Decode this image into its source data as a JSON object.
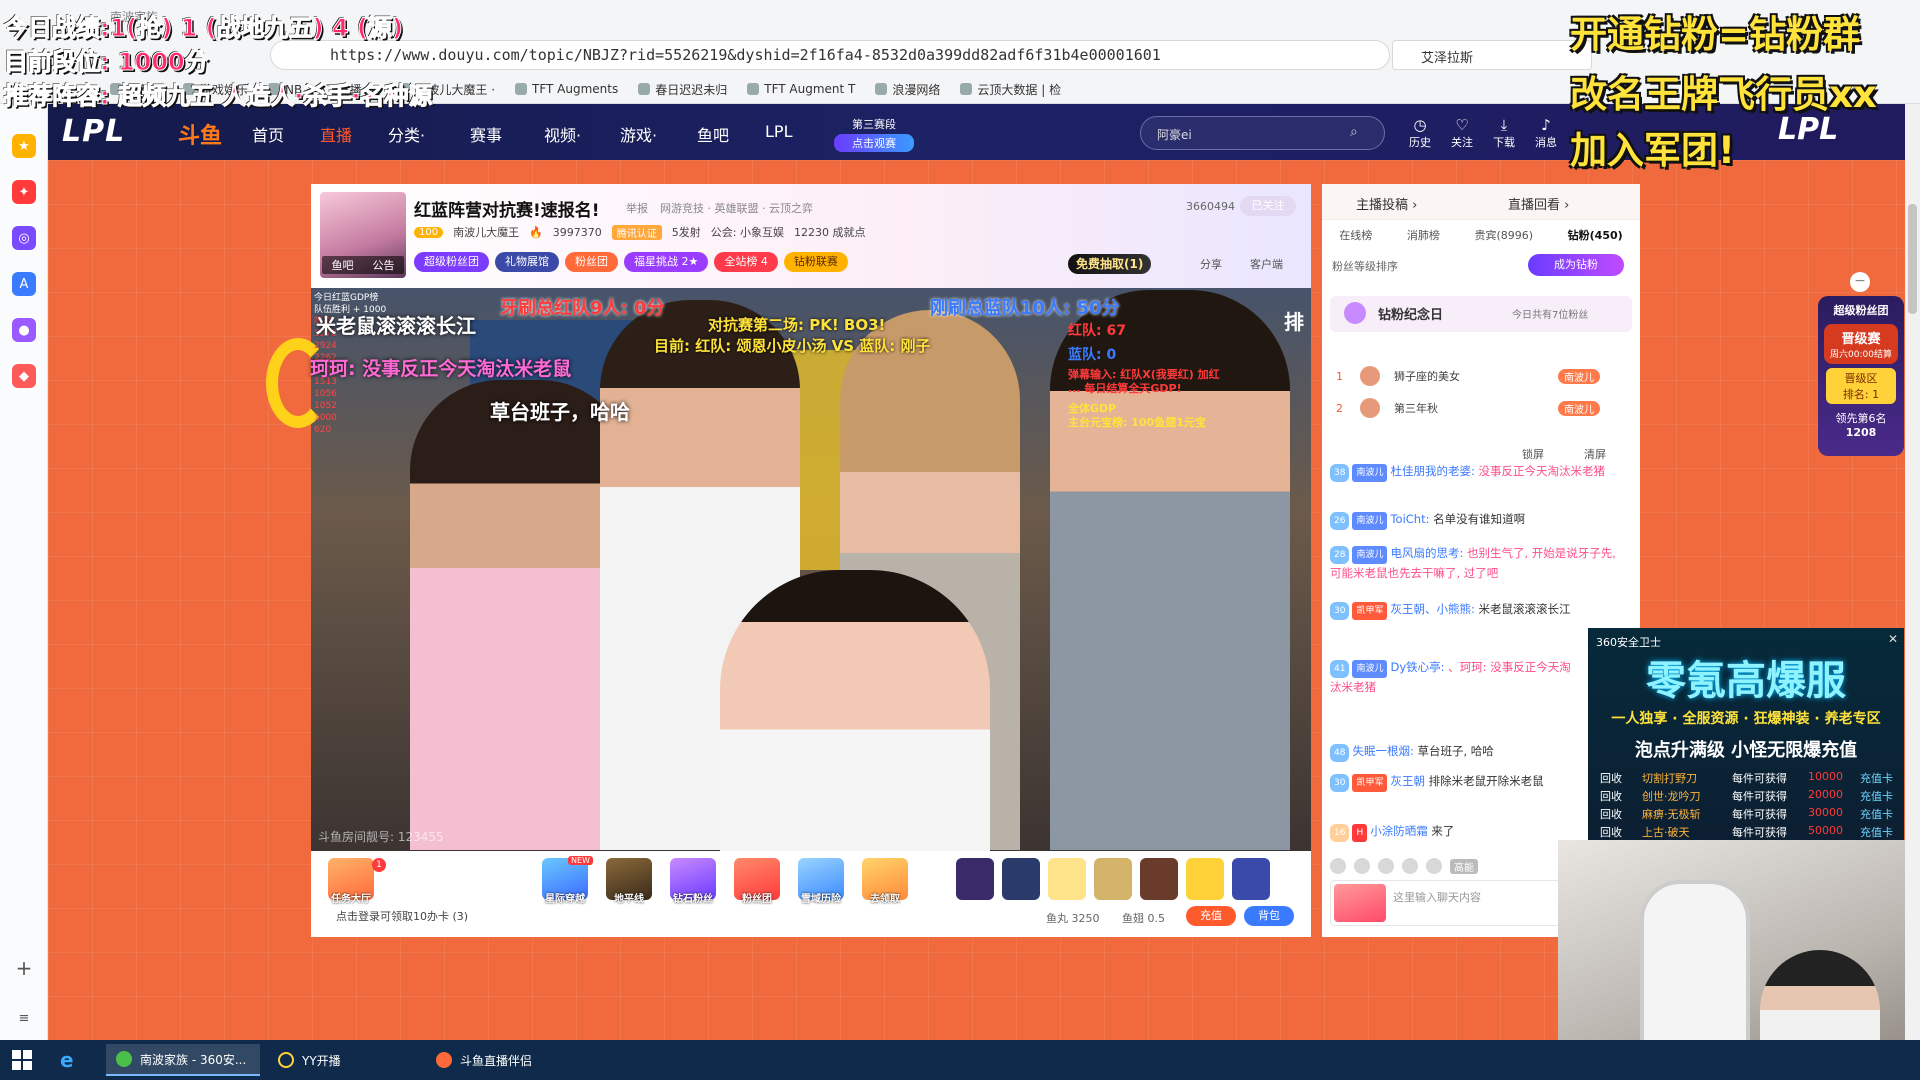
{
  "browser": {
    "window_title": "南波家族",
    "url": "https://www.douyu.com/topic/NBJZ?rid=5526219&dyshid=2f16fa4-8532d0a399dd82adf6f31b4e00001601",
    "search_value": "艾泽拉斯",
    "bookmarks": [
      "点新闻",
      "游戏娱乐",
      "NB · 小飞直播_lo",
      "南波儿大魔王 ·",
      "TFT Augments",
      "春日迟迟未归",
      "TFT Augment T",
      "浪漫网络",
      "云顶大数据 | 检"
    ]
  },
  "stream_overlay_left": {
    "line1": "今日战绩:1(抢) 1 (战地九五) 4 (源)",
    "line2": "目前段位: 1000分",
    "line3": "推荐阵容: 超频九五 人造人·杀手·名种源"
  },
  "stream_overlay_right": {
    "line1": "开通钻粉=钻粉群",
    "line2": "改名王牌飞行员xx",
    "line3": "加入军团!"
  },
  "site_nav": {
    "logo": "LPL",
    "logo_site": "斗鱼",
    "items": [
      "首页",
      "直播",
      "分类·",
      "赛事",
      "视频·",
      "游戏·",
      "鱼吧",
      "LPL"
    ],
    "stage_badge_line1": "第三赛段",
    "stage_badge_line2": "点击观赛",
    "search_placeholder": "阿豪ei",
    "tools": [
      "历史",
      "关注",
      "下载",
      "消息"
    ],
    "right_logo": "LPL"
  },
  "room": {
    "title": "红蓝阵营对抗赛!速报名!",
    "report": "举报",
    "tags": "网游竞技 · 英雄联盟 · 云顶之弈",
    "hot_count": "3660494",
    "followed_label": "已关注",
    "avatar_tabs": [
      "鱼吧",
      "公告"
    ],
    "anchor_level": "100",
    "anchor_name": "南波儿大魔王",
    "heat": "3997370",
    "verify": "腾讯认证",
    "fans_label": "5发射",
    "guild": "公会: 小象互娱",
    "achievement": "12230 成就点",
    "pills": [
      "超级粉丝团",
      "礼物展馆",
      "粉丝团",
      "福星挑战 2★",
      "全站榜 4",
      "钻粉联赛"
    ],
    "free_draw": "免费抽取(1)",
    "share": "分享",
    "client": "客户端"
  },
  "video_overlay": {
    "list_header": "今日红蓝GDP榜",
    "list_sub": "队伍胜利 + 1000",
    "list_rows": [
      "阿豪",
      "5278",
      "2924",
      "2262",
      "2107",
      "1513",
      "1056",
      "1052",
      "1000",
      "620"
    ],
    "red_team": "牙刷总红队9人: 0分",
    "blue_team": "刚刷总蓝队10人: 50分",
    "chat1": "米老鼠滚滚滚长江",
    "match1": "对抗赛第二场: PK! BO3!",
    "match2": "目前: 红队: 颂恩小皮小汤 VS 蓝队: 刚子",
    "chat2": "珂珂: 没事反正今天淘汰米老鼠",
    "red_score": "红队: 67",
    "blue_score": "蓝队: 0",
    "pai": "排",
    "note": "弹幕输入: 红队X(我要红) 加红 ... 每日结算全天GDP!",
    "gdp1": "全体GDP",
    "gdp2": "主台元宝榜: 100鱼翅1元宝",
    "chat3": "草台班子，哈哈",
    "room_id": "斗鱼房间靓号: 123455"
  },
  "toolbar": {
    "gifts": [
      "任务大厅",
      "星际穿越",
      "地平线",
      "钻石粉丝",
      "粉丝团",
      "雪域历险",
      "去领取"
    ],
    "new_badge": "NEW",
    "login_tip": "点击登录可领取10办卡 (3)",
    "fish_ball": "鱼丸 3250",
    "fish_fin": "鱼翅 0.5",
    "recharge": "充值",
    "bag": "背包"
  },
  "right_panel": {
    "tab_a": "主播投稿 ›",
    "tab_b": "直播回看 ›",
    "sub_tabs": [
      "在线榜",
      "消肺榜",
      "贵宾(8996)",
      "钻粉(450)"
    ],
    "sort_label": "粉丝等级排序",
    "become_fan": "成为钻粉",
    "fan_day_title": "钻粉纪念日",
    "fan_day_count": "今日共有7位粉丝",
    "ranks": [
      {
        "n": "1",
        "name": "狮子座的美女",
        "badge": "南波儿"
      },
      {
        "n": "2",
        "name": "第三年秋",
        "badge": "南波儿"
      }
    ],
    "lock": "锁屏",
    "clear": "清屏",
    "messages": [
      {
        "lv": "38",
        "fan": "南波儿",
        "user": "杜佳朋我的老婆:",
        "text": "没事反正今天淘汰米老猪",
        "cls": "pink"
      },
      {
        "lv": "26",
        "fan": "南波儿",
        "user": "ToiCht:",
        "text": "名单没有谁知道啊",
        "cls": ""
      },
      {
        "lv": "28",
        "fan": "南波儿",
        "user": "电风扇的思考:",
        "text": "也别生气了, 开始是说牙子先, 可能米老鼠也先去干嘛了, 过了吧",
        "cls": "pink"
      },
      {
        "lv": "30",
        "fan": "凯甲军",
        "user": "灰王朝、小熊熊:",
        "text": "米老鼠滚滚滚长江",
        "cls": ""
      },
      {
        "lv": "41",
        "fan": "南波儿",
        "user": "Dy铁心亭:",
        "text": "、珂珂: 没事反正今天淘汰米老猪",
        "cls": "pink"
      },
      {
        "lv": "48",
        "fan": "失眠一根烟",
        "user": "失眠一根烟:",
        "text": "草台班子, 哈哈",
        "cls": ""
      },
      {
        "lv": "30",
        "fan": "凯甲军",
        "user": "灰王朝",
        "text": "排除米老鼠开除米老鼠",
        "cls": ""
      },
      {
        "lv": "16",
        "fan": "H",
        "user": "小涂防晒霜",
        "text": "来了",
        "cls": "sys"
      }
    ],
    "chat_placeholder": "这里输入聊天内容",
    "hd_label": "高能"
  },
  "fan_float": {
    "title": "超级粉丝团",
    "event": "晋级赛",
    "time": "周六00:00结算",
    "zone": "晋级区",
    "rank": "排名: 1",
    "lead": "领先第6名",
    "lead_value": "1208"
  },
  "ad": {
    "source": "360安全卫士",
    "headline": "零氪高爆服",
    "line1": "一人独享 · 全服资源 · 狂爆神装 · 养老专区",
    "line2": "泡点升满级 小怪无限爆充值",
    "rows": [
      {
        "a": "回收",
        "b": "切割打野刀",
        "c": "每件可获得",
        "d": "10000",
        "e": "充值卡"
      },
      {
        "a": "回收",
        "b": "创世·龙吟刀",
        "c": "每件可获得",
        "d": "20000",
        "e": "充值卡"
      },
      {
        "a": "回收",
        "b": "麻痹·无极斩",
        "c": "每件可获得",
        "d": "30000",
        "e": "充值卡"
      },
      {
        "a": "回收",
        "b": "上古·破天",
        "c": "每件可获得",
        "d": "50000",
        "e": "充值卡"
      }
    ]
  },
  "taskbar": {
    "items": [
      "南波家族 - 360安...",
      "YY开播",
      "斗鱼直播伴侣"
    ]
  },
  "colors": {
    "page_bg": "#f06a3e",
    "nav_bg": "#1d2266",
    "accent": "#ff5a2c"
  }
}
